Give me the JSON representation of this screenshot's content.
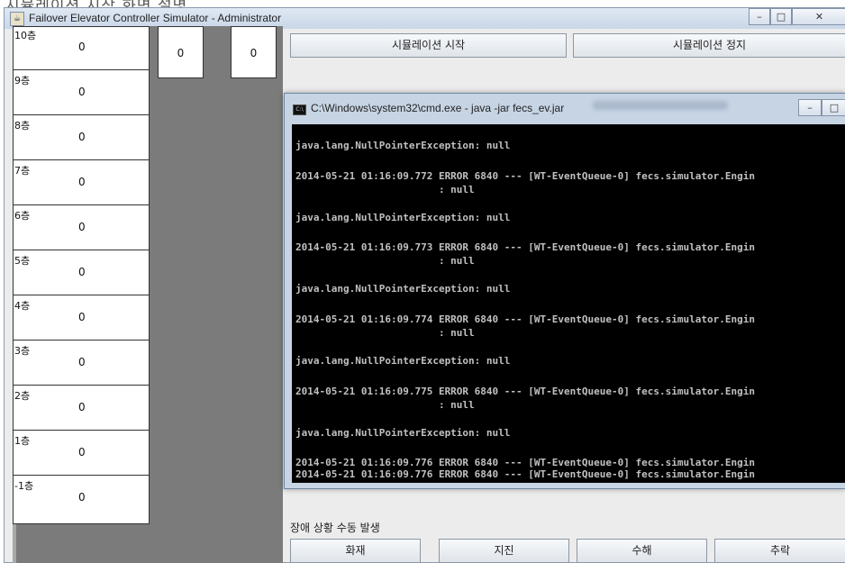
{
  "page_top_text": "시뮬레이션 시작 화면 설명",
  "window": {
    "title": "Failover Elevator Controller Simulator - Administrator",
    "icon": "java-app-icon",
    "controls": [
      "minimize",
      "maximize",
      "close"
    ]
  },
  "floors": [
    {
      "label": "10층",
      "count": "0"
    },
    {
      "label": "9층",
      "count": "0"
    },
    {
      "label": "8층",
      "count": "0"
    },
    {
      "label": "7층",
      "count": "0"
    },
    {
      "label": "6층",
      "count": "0"
    },
    {
      "label": "5층",
      "count": "0"
    },
    {
      "label": "4층",
      "count": "0"
    },
    {
      "label": "3층",
      "count": "0"
    },
    {
      "label": "2층",
      "count": "0"
    },
    {
      "label": "1층",
      "count": "0"
    },
    {
      "label": "-1층",
      "count": "0"
    }
  ],
  "elevators": [
    "0",
    "0"
  ],
  "controls": {
    "start_label": "시뮬레이션 시작",
    "stop_label": "시뮬레이션 정지"
  },
  "failure": {
    "section_label": "장애 상황 수동 발생",
    "buttons": [
      "화재",
      "지진",
      "수해",
      "추락"
    ]
  },
  "cmd": {
    "title": "C:\\Windows\\system32\\cmd.exe - java  -jar fecs_ev.jar",
    "lines": [
      "java.lang.NullPointerException: null",
      "",
      "2014-05-21 01:16:09.772 ERROR 6840 --- [WT-EventQueue-0] fecs.simulator.Engin",
      "                        : null",
      "",
      "java.lang.NullPointerException: null",
      "",
      "2014-05-21 01:16:09.773 ERROR 6840 --- [WT-EventQueue-0] fecs.simulator.Engin",
      "                        : null",
      "",
      "java.lang.NullPointerException: null",
      "",
      "2014-05-21 01:16:09.774 ERROR 6840 --- [WT-EventQueue-0] fecs.simulator.Engin",
      "                        : null",
      "",
      "java.lang.NullPointerException: null",
      "",
      "2014-05-21 01:16:09.775 ERROR 6840 --- [WT-EventQueue-0] fecs.simulator.Engin",
      "                        : null",
      "",
      "java.lang.NullPointerException: null",
      "",
      "2014-05-21 01:16:09.776 ERROR 6840 --- [WT-EventQueue-0] fecs.simulator.Engin",
      "2014-05-21 01:16:09.776 ERROR 6840 --- [WT-EventQueue-0] fecs.simulator.Engin"
    ]
  },
  "colors": {
    "console_bg": "#000000",
    "console_text": "#c0c0c0",
    "window_bg": "#ececec",
    "shaft_gray": "#7b7b7b"
  }
}
